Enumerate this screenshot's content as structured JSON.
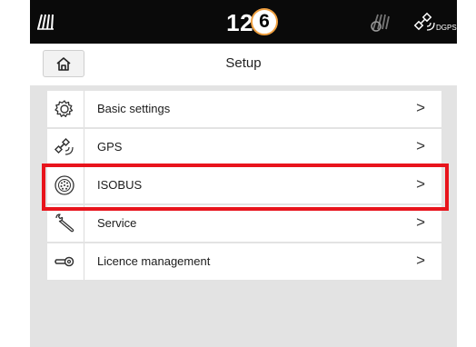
{
  "status": {
    "time": "12.",
    "step_badge": "6",
    "gps_mode": "DGPS"
  },
  "header": {
    "title": "Setup"
  },
  "menu": [
    {
      "label": "Basic settings",
      "icon": "gear-icon"
    },
    {
      "label": "GPS",
      "icon": "satellite-icon"
    },
    {
      "label": "ISOBUS",
      "icon": "isobus-connector-icon"
    },
    {
      "label": "Service",
      "icon": "wrench-icon"
    },
    {
      "label": "Licence management",
      "icon": "key-icon"
    }
  ],
  "highlighted_item": "ISOBUS",
  "colors": {
    "statusbar": "#0a0a0a",
    "content_bg": "#e3e3e3",
    "highlight": "#e8141c",
    "badge_border": "#f0a040"
  }
}
